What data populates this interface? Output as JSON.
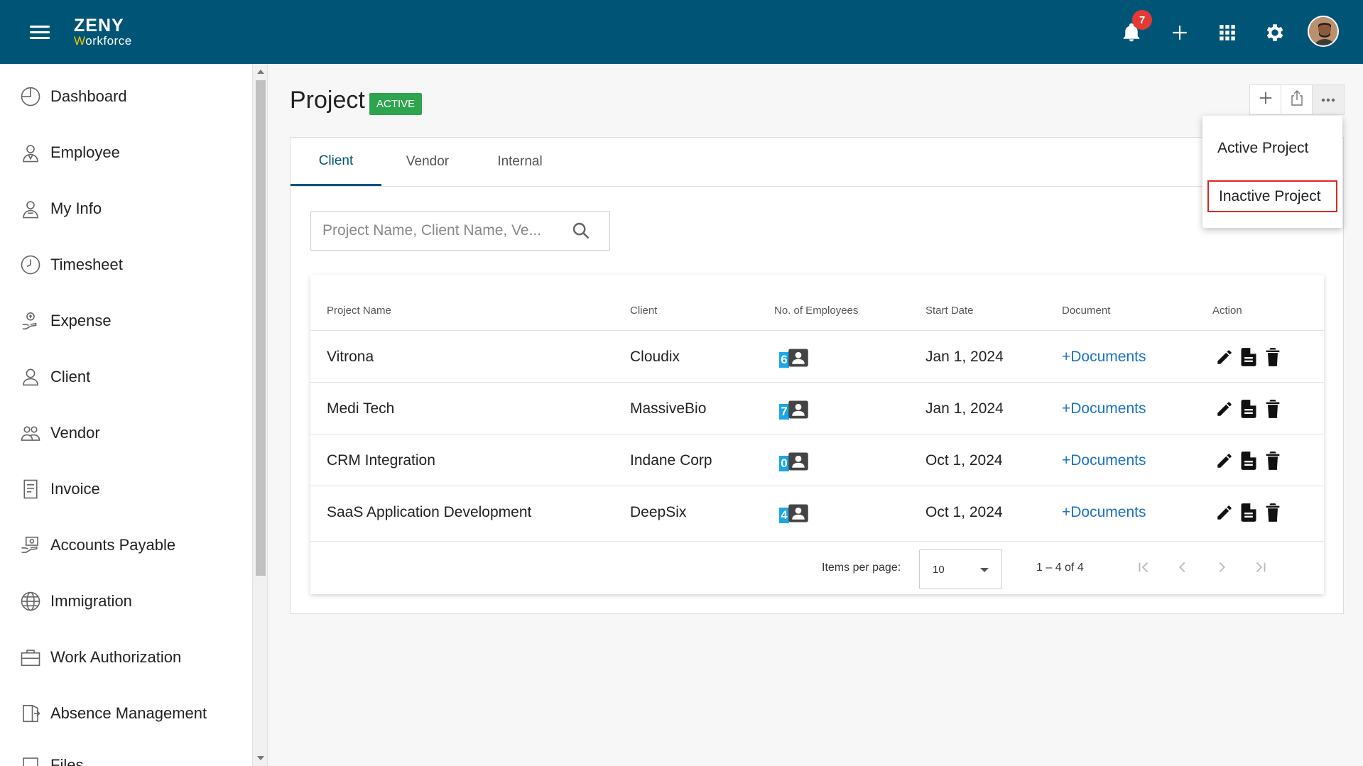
{
  "app": {
    "logo_line1": "ZENY",
    "logo_line2_w": "W",
    "logo_line2_rest": "orkforce",
    "notification_count": "7",
    "brand_color": "#005577"
  },
  "topbar_icons": [
    "menu-icon",
    "bell-icon",
    "plus-icon",
    "apps-grid-icon",
    "gear-icon",
    "avatar"
  ],
  "sidebar": {
    "items": [
      {
        "label": "Dashboard",
        "icon": "dashboard-icon"
      },
      {
        "label": "Employee",
        "icon": "employee-icon"
      },
      {
        "label": "My Info",
        "icon": "my-info-icon"
      },
      {
        "label": "Timesheet",
        "icon": "clock-icon"
      },
      {
        "label": "Expense",
        "icon": "expense-icon"
      },
      {
        "label": "Client",
        "icon": "client-icon"
      },
      {
        "label": "Vendor",
        "icon": "vendor-icon"
      },
      {
        "label": "Invoice",
        "icon": "invoice-icon"
      },
      {
        "label": "Accounts Payable",
        "icon": "accounts-payable-icon"
      },
      {
        "label": "Immigration",
        "icon": "globe-icon"
      },
      {
        "label": "Work Authorization",
        "icon": "briefcase-icon"
      },
      {
        "label": "Absence Management",
        "icon": "exit-door-icon"
      },
      {
        "label": "Files",
        "icon": "files-icon"
      }
    ]
  },
  "page": {
    "title": "Project",
    "status": "ACTIVE",
    "status_color": "#2ea44f"
  },
  "toolbar": {
    "buttons": [
      "add-icon",
      "share-icon",
      "more-icon"
    ]
  },
  "dropdown": {
    "items": [
      "Active Project",
      "Inactive Project"
    ],
    "highlighted": "Inactive Project"
  },
  "tabs": [
    {
      "label": "Client",
      "active": true
    },
    {
      "label": "Vendor",
      "active": false
    },
    {
      "label": "Internal",
      "active": false
    }
  ],
  "search": {
    "placeholder": "Project Name, Client Name, Ve...",
    "value": ""
  },
  "table": {
    "columns": [
      "Project Name",
      "Client",
      "No. of Employees",
      "Start Date",
      "Document",
      "Action"
    ],
    "rows": [
      {
        "project": "Vitrona",
        "client": "Cloudix",
        "employees": "6",
        "start": "Jan 1, 2024",
        "document": "+Documents"
      },
      {
        "project": "Medi Tech",
        "client": "MassiveBio",
        "employees": "7",
        "start": "Jan 1, 2024",
        "document": "+Documents"
      },
      {
        "project": "CRM Integration",
        "client": "Indane Corp",
        "employees": "0",
        "start": "Oct 1, 2024",
        "document": "+Documents"
      },
      {
        "project": "SaaS Application Development",
        "client": "DeepSix",
        "employees": "4",
        "start": "Oct 1, 2024",
        "document": "+Documents"
      }
    ]
  },
  "pagination": {
    "items_per_page_label": "Items per page:",
    "items_per_page": "10",
    "range": "1 – 4 of 4"
  }
}
